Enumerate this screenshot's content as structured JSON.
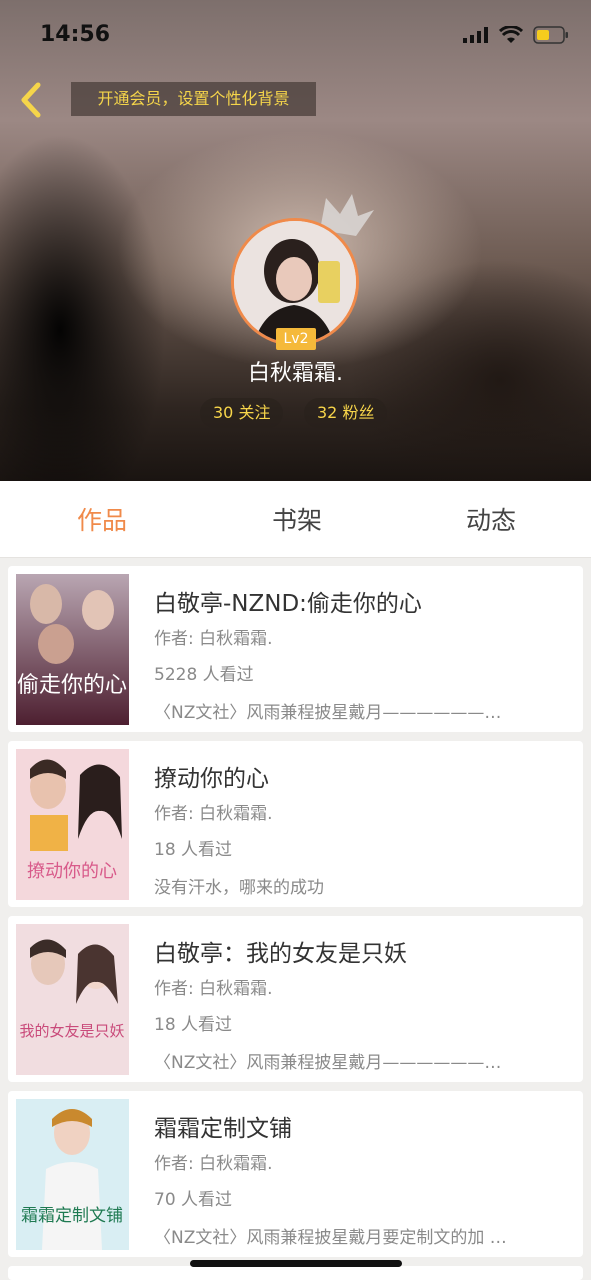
{
  "status_bar": {
    "time": "14:56"
  },
  "header": {
    "vip_banner": "开通会员，设置个性化背景",
    "level": "Lv2",
    "username": "白秋霜霜.",
    "following": "30 关注",
    "followers": "32 粉丝"
  },
  "tabs": [
    {
      "label": "作品",
      "active": true
    },
    {
      "label": "书架",
      "active": false
    },
    {
      "label": "动态",
      "active": false
    }
  ],
  "books": [
    {
      "title": "白敬亭-NZND:偷走你的心",
      "author": "作者: 白秋霜霜.",
      "views": "5228 人看过",
      "desc": "〈NZ文社〉风雨兼程披星戴月——————…",
      "cover_text": "偷走你的心",
      "cover_color": "#5a2a3a"
    },
    {
      "title": "撩动你的心",
      "author": "作者: 白秋霜霜.",
      "views": "18 人看过",
      "desc": "没有汗水，哪来的成功",
      "cover_text": "撩动你的心",
      "cover_color": "#f4d8dc"
    },
    {
      "title": "白敬亭：我的女友是只妖",
      "author": "作者: 白秋霜霜.",
      "views": "18 人看过",
      "desc": "〈NZ文社〉风雨兼程披星戴月——————…",
      "cover_text": "我的女友是只妖",
      "cover_color": "#f1dde0"
    },
    {
      "title": "霜霜定制文铺",
      "author": "作者: 白秋霜霜.",
      "views": "70 人看过",
      "desc": "〈NZ文社〉风雨兼程披星戴月要定制文的加 …",
      "cover_text": "霜霜定制文铺",
      "cover_color": "#d9eef3"
    }
  ]
}
